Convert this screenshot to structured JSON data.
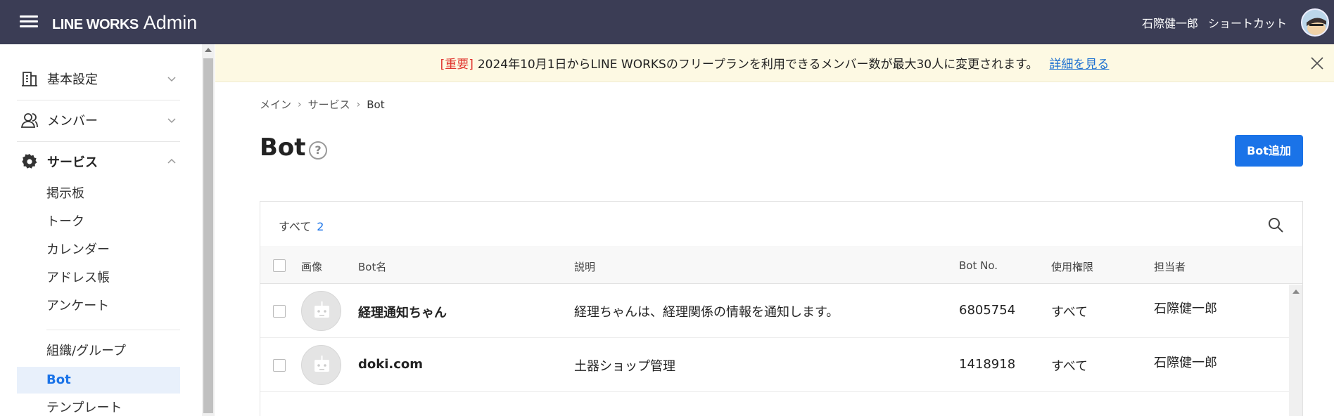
{
  "header": {
    "brand": "LINE WORKS",
    "app": "Admin",
    "user_name": "石際健一郎",
    "shortcut": "ショートカット"
  },
  "sidebar": {
    "groups": [
      {
        "label": "基本設定",
        "icon": "building-icon",
        "expanded": false
      },
      {
        "label": "メンバー",
        "icon": "members-icon",
        "expanded": false
      },
      {
        "label": "サービス",
        "icon": "gear-icon",
        "expanded": true
      }
    ],
    "service_items": [
      "掲示板",
      "トーク",
      "カレンダー",
      "アドレス帳",
      "アンケート"
    ],
    "service_items2": [
      "組織/グループ",
      "Bot",
      "テンプレート"
    ],
    "active_item": "Bot"
  },
  "notice": {
    "tag": "[重要]",
    "text": "2024年10月1日からLINE WORKSのフリープランを利用できるメンバー数が最大30人に変更されます。",
    "link": "詳細を見る"
  },
  "breadcrumb": [
    "メイン",
    "サービス",
    "Bot"
  ],
  "page": {
    "title": "Bot",
    "help": "?",
    "add_button": "Bot追加"
  },
  "filter": {
    "all_label": "すべて",
    "count": "2"
  },
  "table": {
    "headers": [
      "画像",
      "Bot名",
      "説明",
      "Bot No.",
      "使用権限",
      "担当者"
    ],
    "rows": [
      {
        "name": "経理通知ちゃん",
        "description": "経理ちゃんは、経理関係の情報を通知します。",
        "bot_no": "6805754",
        "permission": "すべて",
        "manager": "石際健一郎"
      },
      {
        "name": "doki.com",
        "description": "土器ショップ管理",
        "bot_no": "1418918",
        "permission": "すべて",
        "manager": "石際健一郎"
      }
    ]
  },
  "colors": {
    "topbar": "#3b3d55",
    "accent": "#1a73e8",
    "notice_bg": "#fdf9e3",
    "important": "#e0342d"
  }
}
